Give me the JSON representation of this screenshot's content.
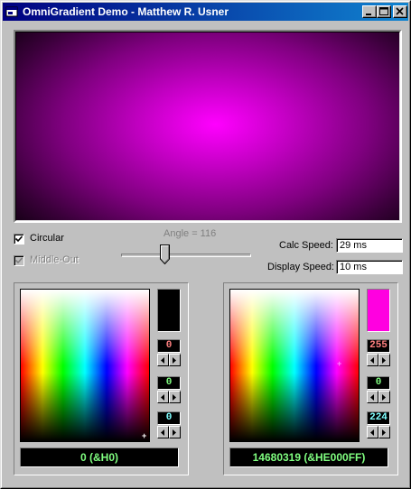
{
  "window": {
    "title": "OmniGradient Demo - Matthew R. Usner",
    "app_icon": "app-window-icon"
  },
  "options": {
    "circular": {
      "label": "Circular",
      "checked": true,
      "enabled": true
    },
    "middle_out": {
      "label": "Middle-Out",
      "checked": true,
      "enabled": false
    }
  },
  "angle": {
    "label": "Angle = 116",
    "slider_fraction": 0.32
  },
  "timing": {
    "calc_label": "Calc Speed:",
    "calc_value": "29 ms",
    "display_label": "Display Speed:",
    "display_value": "10 ms"
  },
  "left_color": {
    "swatch_color": "#000000",
    "red": "0",
    "green": "0",
    "blue": "0",
    "readout": "0 (&H0)"
  },
  "right_color": {
    "swatch_color": "#ff00e0",
    "red": "255",
    "green": "0",
    "blue": "224",
    "readout": "14680319 (&HE000FF)"
  },
  "colors": {
    "titlebar_start": "#000080",
    "titlebar_end": "#1084d0",
    "face": "#c0c0c0",
    "gradient_center": "#ff00ff"
  }
}
